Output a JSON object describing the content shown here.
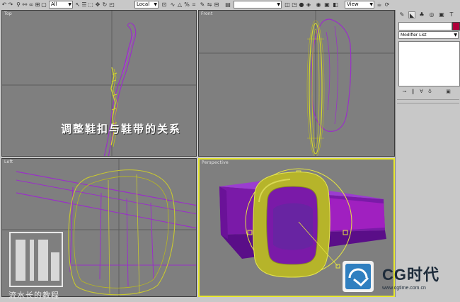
{
  "toolbar": {
    "selection_filter": "All",
    "coord_system": "Local",
    "named_selection": "",
    "view_mode": "View"
  },
  "viewports": {
    "top_label": "Top",
    "front_label": "Front",
    "left_label": "Left",
    "perspective_label": "Perspective"
  },
  "overlay": {
    "caption": "调整鞋扣与鞋带的关系",
    "left_logo_text": "流水长的教程"
  },
  "panel": {
    "modifier_list": "Modifier List",
    "object_color": "#b0003a"
  },
  "watermark": {
    "brand": "CG时代",
    "url": "www.cgtime.com.cn"
  },
  "icons": [
    "undo-icon",
    "redo-icon",
    "link-icon",
    "unlink-icon",
    "bind-icon",
    "select-icon",
    "select-region-icon",
    "move-icon",
    "rotate-icon",
    "scale-icon",
    "mirror-icon",
    "align-icon",
    "render-icon"
  ]
}
